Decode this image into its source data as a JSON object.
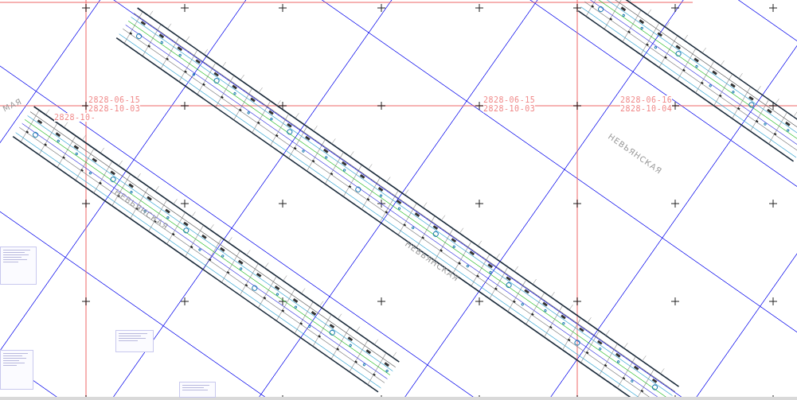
{
  "sheet_labels": [
    {
      "lines": [
        "2828-06-15",
        "2828-10-03"
      ]
    },
    {
      "lines": [
        "2828-10-"
      ]
    },
    {
      "lines": [
        "2828-06-15",
        "2828-10-03"
      ]
    },
    {
      "lines": [
        "2828-06-16",
        "2828-10-04"
      ]
    }
  ],
  "street_labels": [
    {
      "text": "МАЯ"
    },
    {
      "text": "НЕВЬЯНСКАЯ"
    },
    {
      "text": "НЕВЬЯНСКАЯ"
    },
    {
      "text": "НЕВЬЯНСКАЯ"
    }
  ]
}
